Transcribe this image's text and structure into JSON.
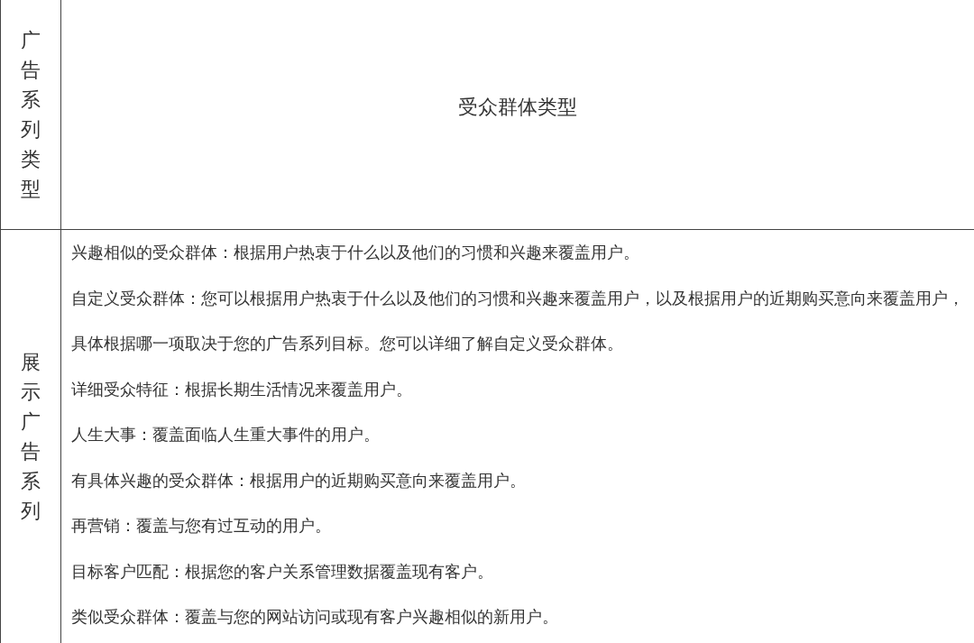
{
  "table": {
    "columns": [
      {
        "header": "广告系列类型"
      },
      {
        "header": "受众群体类型"
      }
    ],
    "rows": [
      {
        "campaign_type": "展示广告系列",
        "audience_types": [
          "兴趣相似的受众群体：根据用户热衷于什么以及他们的习惯和兴趣来覆盖用户。",
          "自定义受众群体：您可以根据用户热衷于什么以及他们的习惯和兴趣来覆盖用户，以及根据用户的近期购买意向来覆盖用户，具体根据哪一项取决于您的广告系列目标。您可以详细了解自定义受众群体。",
          "详细受众特征：根据长期生活情况来覆盖用户。",
          "人生大事：覆盖面临人生重大事件的用户。",
          "有具体兴趣的受众群体：根据用户的近期购买意向来覆盖用户。",
          "再营销：覆盖与您有过互动的用户。",
          "目标客户匹配：根据您的客户关系管理数据覆盖现有客户。",
          "类似受众群体：覆盖与您的网站访问或现有客户兴趣相似的新用户。"
        ]
      }
    ]
  }
}
